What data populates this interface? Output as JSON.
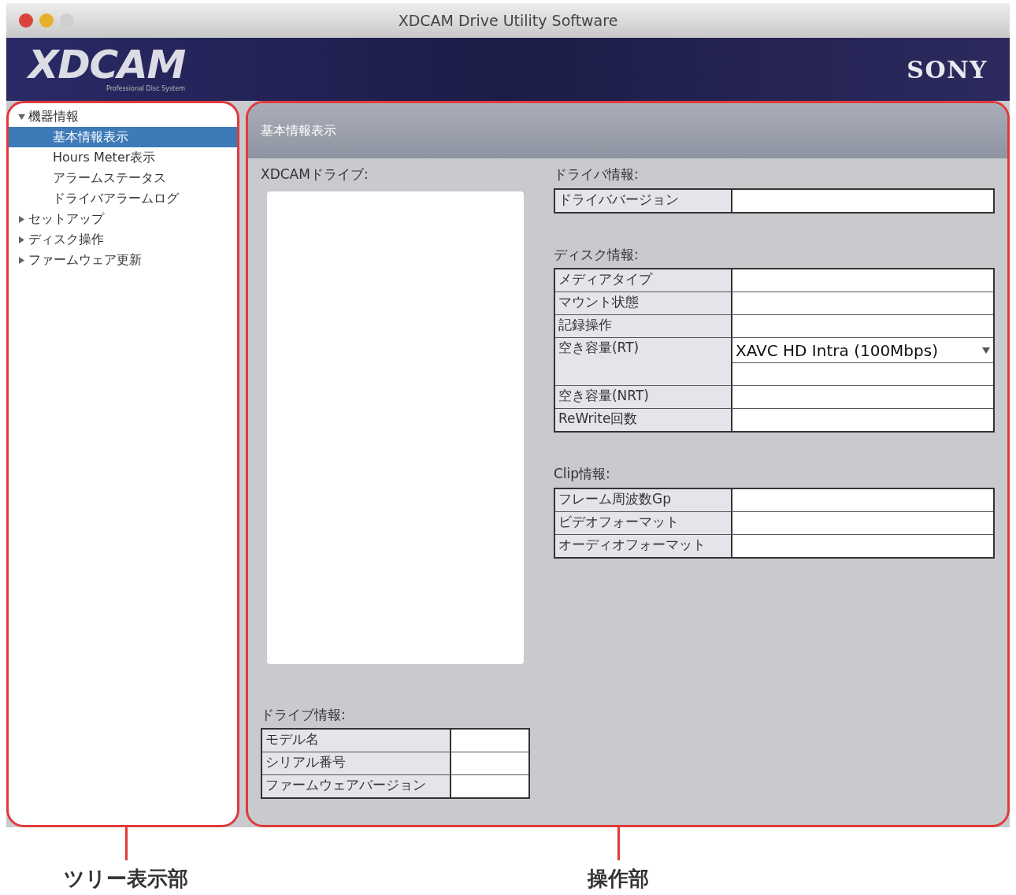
{
  "window": {
    "title": "XDCAM Drive Utility Software"
  },
  "banner": {
    "logo": "XDCAM",
    "tagline": "Professional Disc System",
    "brand": "SONY"
  },
  "tree": [
    {
      "label": "機器情報",
      "expanded": true,
      "selected": false,
      "children": [
        {
          "label": "基本情報表示",
          "selected": true
        },
        {
          "label": "Hours Meter表示",
          "selected": false
        },
        {
          "label": "アラームステータス",
          "selected": false
        },
        {
          "label": "ドライバアラームログ",
          "selected": false
        }
      ]
    },
    {
      "label": "セットアップ",
      "expanded": false,
      "selected": false
    },
    {
      "label": "ディスク操作",
      "expanded": false,
      "selected": false
    },
    {
      "label": "ファームウェア更新",
      "expanded": false,
      "selected": false
    }
  ],
  "panel": {
    "title": "基本情報表示",
    "drive_list_label": "XDCAMドライブ:",
    "drive_info": {
      "label": "ドライブ情報:",
      "rows": [
        {
          "kind": "text",
          "label": "モデル名"
        },
        {
          "kind": "text",
          "label": "シリアル番号"
        },
        {
          "kind": "text",
          "label": "ファームウェアバージョン"
        }
      ]
    },
    "driver_info": {
      "label": "ドライバ情報:",
      "rows": [
        {
          "kind": "text",
          "label": "ドライババージョン"
        }
      ]
    },
    "disc_info": {
      "label": "ディスク情報:",
      "rows": [
        {
          "kind": "text",
          "label": "メディアタイプ"
        },
        {
          "kind": "text",
          "label": "マウント状態"
        },
        {
          "kind": "text",
          "label": "記録操作"
        },
        {
          "kind": "dropdown",
          "label": "空き容量(RT)",
          "value": "XAVC HD Intra (100Mbps)"
        },
        {
          "kind": "text",
          "label": "空き容量(NRT)"
        },
        {
          "kind": "text",
          "label": "ReWrite回数"
        }
      ]
    },
    "clip_info": {
      "label": "Clip情報:",
      "rows": [
        {
          "kind": "text",
          "label": "フレーム周波数Gp"
        },
        {
          "kind": "text",
          "label": "ビデオフォーマット"
        },
        {
          "kind": "text",
          "label": "オーディオフォーマット"
        }
      ]
    }
  },
  "callouts": [
    {
      "label": "ツリー表示部"
    },
    {
      "label": "操作部"
    }
  ]
}
